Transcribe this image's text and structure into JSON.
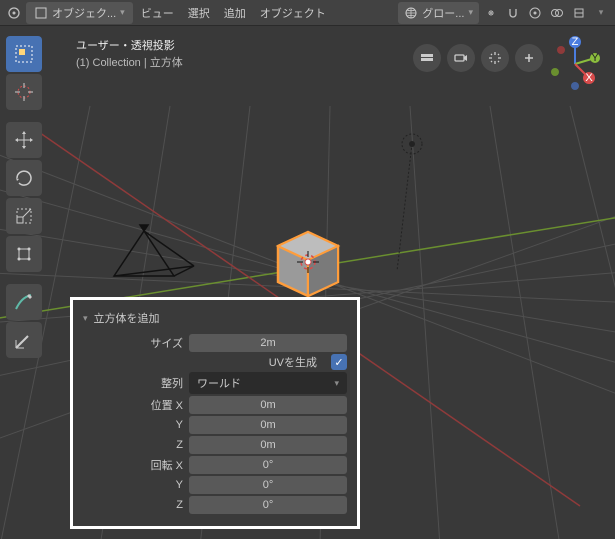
{
  "header": {
    "mode_label": "オブジェク...",
    "view": "ビュー",
    "select": "選択",
    "add": "追加",
    "object": "オブジェクト",
    "orientation_label": "グロー..."
  },
  "overlay": {
    "line1": "ユーザー・透視投影",
    "line2": "(1) Collection | 立方体"
  },
  "panel": {
    "title": "立方体を追加",
    "size_label": "サイズ",
    "size_value": "2m",
    "uv_label": "UVを生成",
    "align_label": "整列",
    "align_value": "ワールド",
    "location_label": "位置 X",
    "loc_x": "0m",
    "loc_y": "0m",
    "loc_z": "0m",
    "rotation_label": "回転 X",
    "rot_x": "0°",
    "rot_y": "0°",
    "rot_z": "0°",
    "axis_y": "Y",
    "axis_z": "Z"
  }
}
